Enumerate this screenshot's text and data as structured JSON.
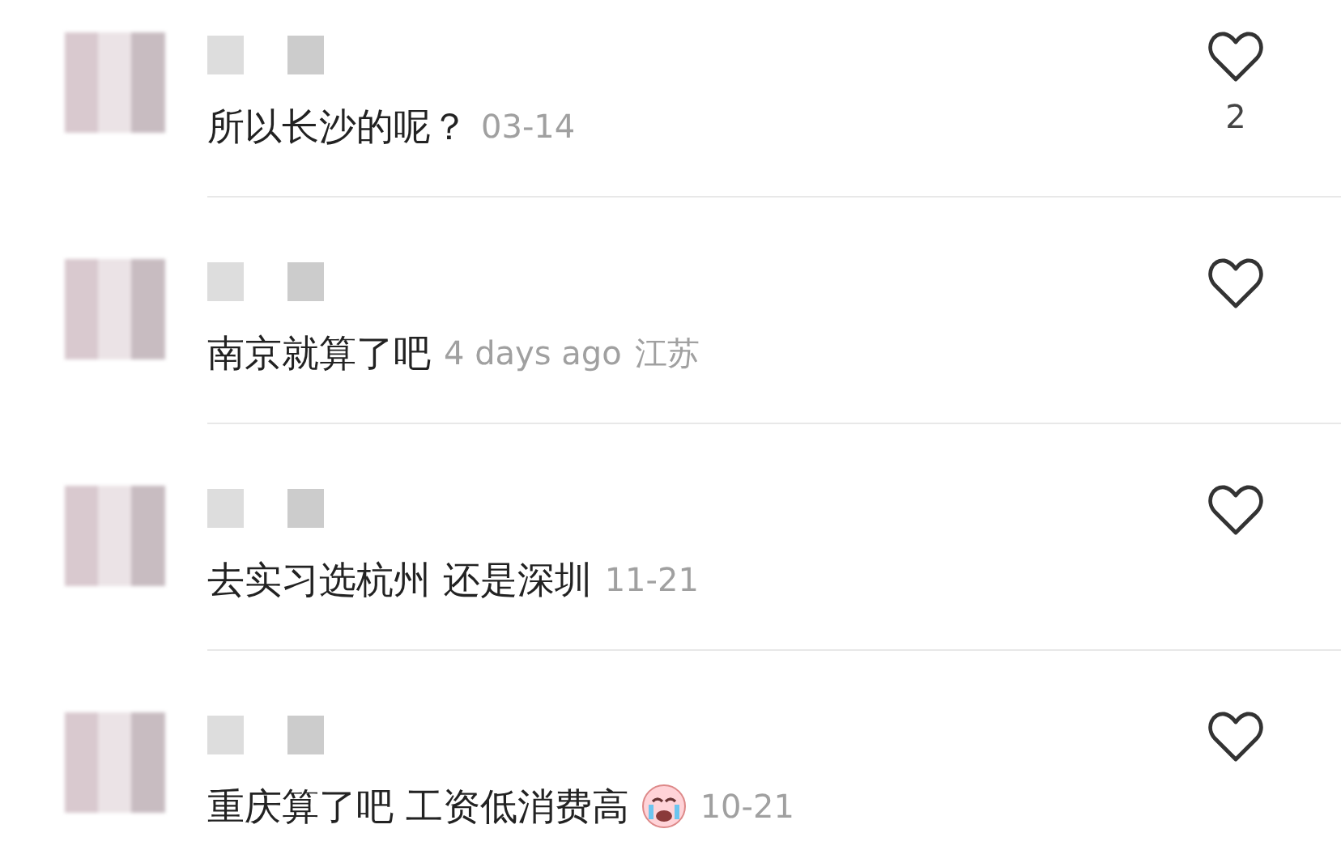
{
  "comments": [
    {
      "text": "所以长沙的呢？",
      "has_emoji": false,
      "date": "03-14",
      "likes": "2"
    },
    {
      "text": "南京就算了吧",
      "has_emoji": false,
      "date": "4 days ago",
      "location": "江苏"
    },
    {
      "text": "去实习选杭州 还是深圳",
      "has_emoji": false,
      "date": "11-21"
    },
    {
      "text": "重庆算了吧 工资低消费高",
      "has_emoji": true,
      "date": "10-21"
    }
  ]
}
